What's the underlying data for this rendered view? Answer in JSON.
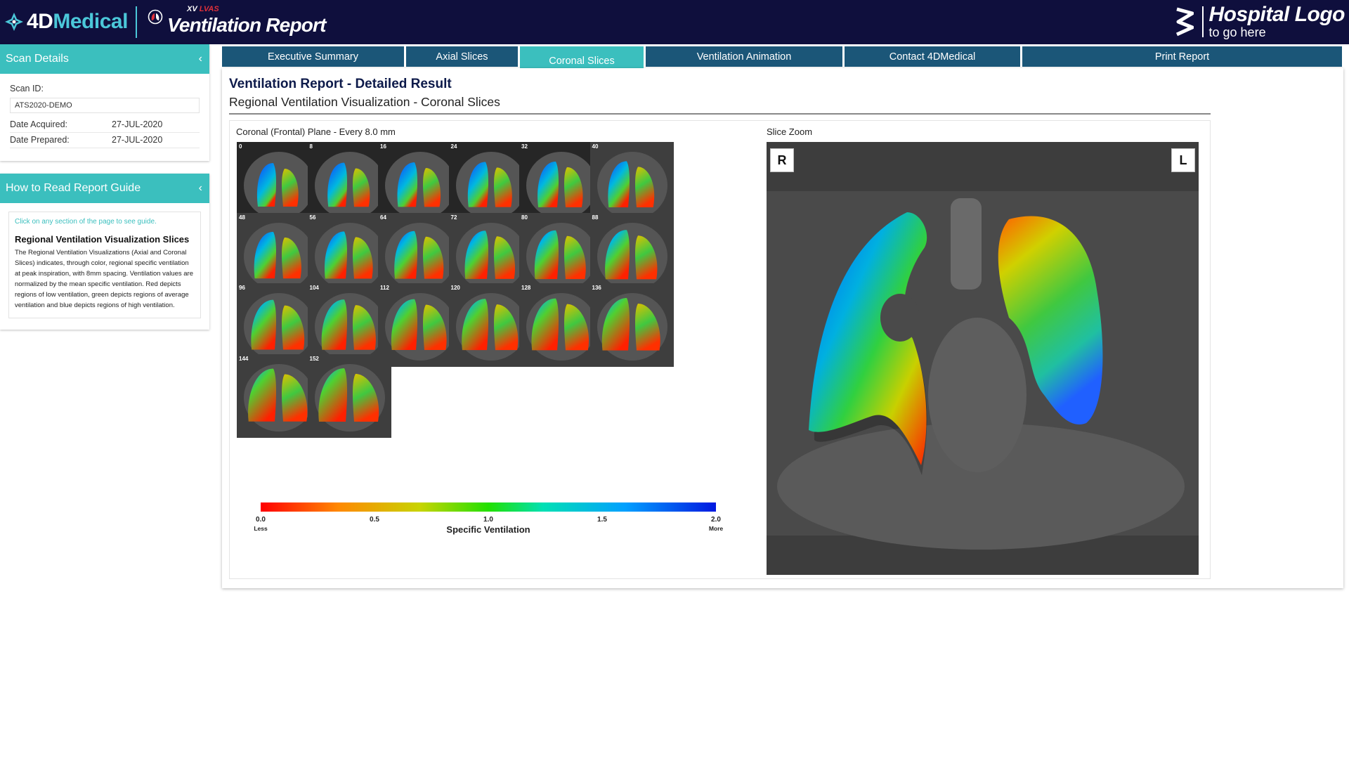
{
  "header": {
    "brand_prefix": "4D",
    "brand_name": "Medical",
    "product_super_xv": "XV",
    "product_super_lvas": "LVAS",
    "product_title": "Ventilation Report",
    "hospital_line1": "Hospital Logo",
    "hospital_line2": "to go here"
  },
  "sidebar": {
    "scan_details": {
      "title": "Scan Details",
      "scan_id_label": "Scan ID:",
      "scan_id_value": "ATS2020-DEMO",
      "date_acquired_label": "Date Acquired:",
      "date_acquired_value": "27-JUL-2020",
      "date_prepared_label": "Date Prepared:",
      "date_prepared_value": "27-JUL-2020"
    },
    "guide": {
      "title": "How to Read Report Guide",
      "hint": "Click on any section of the page to see guide.",
      "section_title": "Regional Ventilation Visualization Slices",
      "section_text": "The Regional Ventilation Visualizations (Axial and Coronal Slices) indicates, through color, regional specific ventilation at peak inspiration, with 8mm spacing. Ventilation values are normalized by the mean specific ventilation. Red depicts regions of low ventilation, green depicts regions of average ventilation and blue depicts regions of high ventilation."
    }
  },
  "tabs": [
    {
      "label": "Executive Summary",
      "active": false
    },
    {
      "label": "Axial Slices",
      "active": false
    },
    {
      "label": "Coronal Slices",
      "active": true
    },
    {
      "label": "Ventilation Animation",
      "active": false
    },
    {
      "label": "Contact 4DMedical",
      "active": false
    },
    {
      "label": "Print Report",
      "active": false
    }
  ],
  "main": {
    "title": "Ventilation Report - Detailed Result",
    "subtitle": "Regional Ventilation Visualization - Coronal Slices",
    "plane_label": "Coronal (Frontal) Plane - Every 8.0 mm",
    "zoom_label": "Slice Zoom",
    "orient_right": "R",
    "orient_left": "L"
  },
  "slices": [
    "0",
    "8",
    "16",
    "24",
    "32",
    "40",
    "48",
    "56",
    "64",
    "72",
    "80",
    "88",
    "96",
    "104",
    "112",
    "120",
    "128",
    "136",
    "144",
    "152"
  ],
  "colorbar": {
    "title": "Specific Ventilation",
    "ticks": [
      "0.0",
      "0.5",
      "1.0",
      "1.5",
      "2.0"
    ],
    "low_label": "Less",
    "high_label": "More",
    "colors": [
      "#ff0000",
      "#ff8800",
      "#c8d400",
      "#22e000",
      "#00e0b4",
      "#00a0ff",
      "#0018e0"
    ]
  }
}
